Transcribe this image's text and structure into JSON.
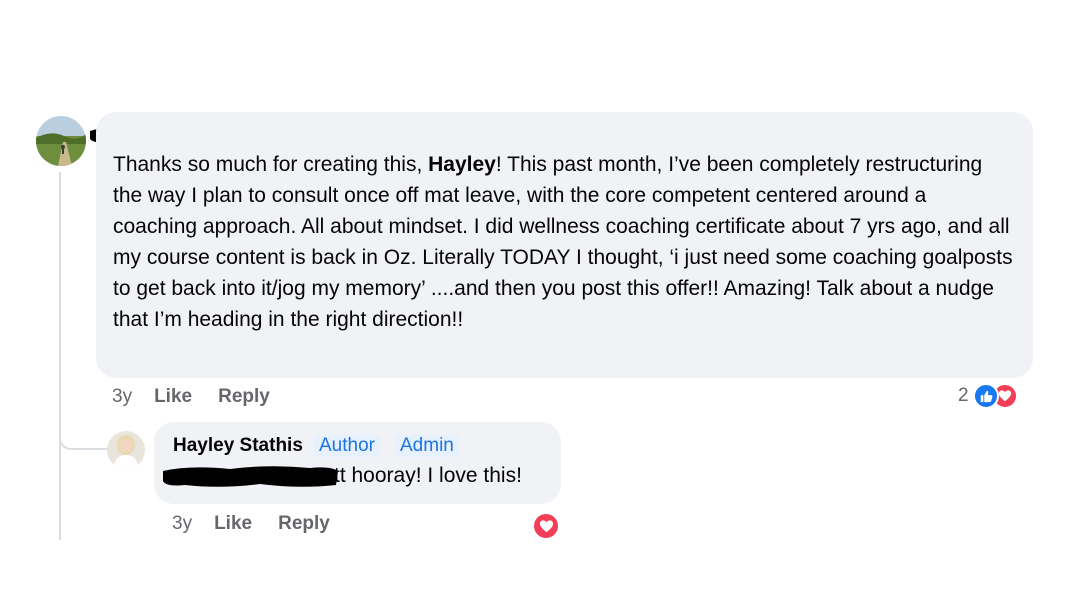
{
  "comment": {
    "text_before": "Thanks so much for creating this, ",
    "mention": "Hayley",
    "text_after": "! This past month, I’ve been completely restructuring the way I plan to consult once off mat leave, with the core competent centered around a coaching approach. All about mindset. I did wellness coaching certificate about 7 yrs ago, and all my course content is back in Oz. Literally TODAY I thought, ‘i just need some coaching goalposts to get back into it/jog my memory’ ....and then you post this offer!! Amazing! Talk about a nudge that I’m heading in the right direction!!",
    "time": "3y",
    "like_label": "Like",
    "reply_label": "Reply",
    "reaction_count": "2"
  },
  "reply": {
    "author": "Hayley Stathis",
    "badges": [
      "Author",
      "Admin"
    ],
    "text": "tt hooray! I love this!",
    "time": "3y",
    "like_label": "Like",
    "reply_label": "Reply"
  },
  "colors": {
    "bubble": "#f0f2f5",
    "like_blue": "#1877f2",
    "love_red": "#f33e58",
    "meta_gray": "#65676b",
    "badge_blue": "#1b74e4"
  },
  "icons": {
    "like": "thumbs-up-icon",
    "love": "heart-icon"
  }
}
